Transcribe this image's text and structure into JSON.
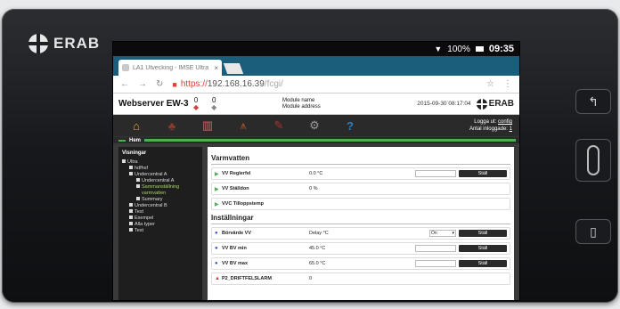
{
  "device": {
    "brand": "ERAB"
  },
  "status": {
    "signal": "▼",
    "battery": "100%",
    "time": "09:35"
  },
  "browser": {
    "tab_title": "LA1 Utvecking - IMSE Ultra",
    "tab_close": "×",
    "url_proto": "https://",
    "url_host": "192.168.16.39",
    "url_path": "/fcgi/"
  },
  "header": {
    "app_name": "Webserver EW-3",
    "alarm_a": "0",
    "alarm_b": "0",
    "module_name": "Module name",
    "module_address": "Module address",
    "datetime": "2015-09-30 08:17:04",
    "logo": "ERAB"
  },
  "nav": {
    "items": [
      "home-icon",
      "bell-icon",
      "chart-icon",
      "tower-icon",
      "tool-icon",
      "gear-icon",
      "help-icon"
    ],
    "help_glyph": "?",
    "user_line1_prefix": "Logga ut:",
    "user_name": "config",
    "user_line2_prefix": "Antal inloggade:",
    "user_count": "1",
    "breadcrumb": "Hem"
  },
  "sidebar": {
    "title": "Visningar",
    "items": {
      "ultra": "Ultra",
      "hdfhsf": "hdfhsf",
      "uc_a": "Undercentral A",
      "uc_a_child": "Undercentral A",
      "summary_view1": "Sammanställning",
      "summary_view2": "varmvatten",
      "summary": "Summary",
      "uc_b": "Undercentral B",
      "test": "Test",
      "exempel": "Exempel",
      "alla_typer": "Alla typer",
      "test2": "Test"
    }
  },
  "main": {
    "section_varmvatten": "Varmvatten",
    "section_installningar": "Inställningar",
    "button_label": "Ställ",
    "rows": {
      "vv_reglerfel": {
        "label": "VV Reglerfel",
        "value": "0.0 °C"
      },
      "vv_stalldon": {
        "label": "VV Ställdon",
        "value": "0 %"
      },
      "vvc_tillopp": {
        "label": "VVC Tilloppstemp",
        "value": ""
      },
      "borvarde_vv": {
        "label": "Börvärde VV",
        "value": "Delay °C",
        "select": "On"
      },
      "vv_bv_min": {
        "label": "VV BV min",
        "value": "45.0 °C"
      },
      "vv_bv_max": {
        "label": "VV BV max",
        "value": "65.0 °C"
      },
      "p2_driftfel": {
        "label": "P2_DRIFTFELSLARM",
        "value": "0"
      }
    }
  },
  "colors": {
    "accent_green": "#4caf50",
    "header_dark": "#2a2a2a",
    "tab_blue": "#1b5e7c"
  }
}
